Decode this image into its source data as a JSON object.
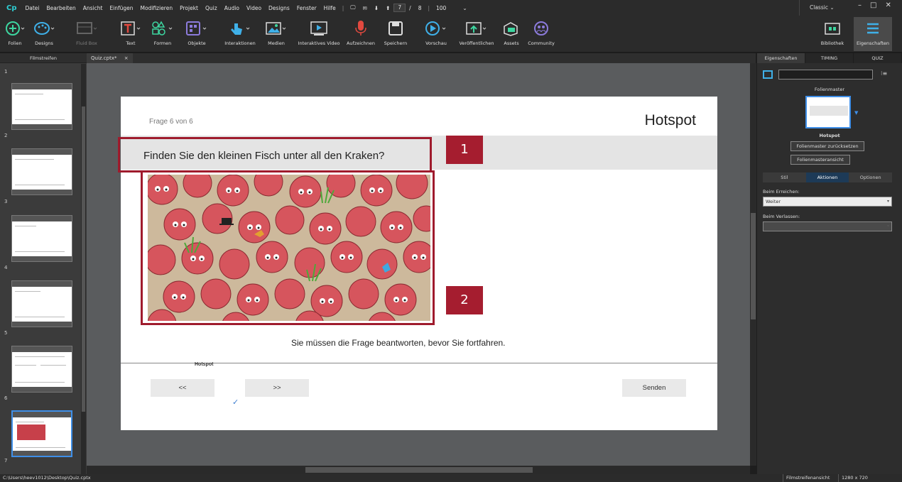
{
  "menubar": {
    "logo": "Cp",
    "items": [
      "Datei",
      "Bearbeiten",
      "Ansicht",
      "Einfügen",
      "Modifizieren",
      "Projekt",
      "Quiz",
      "Audio",
      "Video",
      "Designs",
      "Fenster",
      "Hilfe"
    ],
    "current_slide": "7",
    "slide_sep": "/",
    "total_slides": "8",
    "zoom": "100",
    "workspace": "Classic",
    "window_controls": [
      "–",
      "□",
      "✕"
    ]
  },
  "toolbar": {
    "items": [
      "Folien",
      "Designs",
      "Fluid Box",
      "Text",
      "Formen",
      "Objekte",
      "Interaktionen",
      "Medien",
      "Interaktives Video",
      "Aufzeichnen",
      "Speichern",
      "Vorschau",
      "Veröffentlichen",
      "Assets",
      "Community"
    ],
    "right_items": [
      "Bibliothek",
      "Eigenschaften"
    ]
  },
  "filmstrip": {
    "title": "Filmstreifen",
    "slide_numbers": [
      "1",
      "2",
      "3",
      "4",
      "5",
      "6",
      "7"
    ]
  },
  "document": {
    "tab": "Quiz.cptx*",
    "tab_close": "×"
  },
  "slide": {
    "progress": "Frage 6 von 6",
    "type_title": "Hotspot",
    "question": "Finden Sie den kleinen Fisch unter all den Kraken?",
    "badge1": "1",
    "badge2": "2",
    "warning": "Sie müssen die Frage beantworten, bevor Sie fortfahren.",
    "footer_label": "Hotspot",
    "prev": "<<",
    "next": ">>",
    "submit": "Senden",
    "check": "✓"
  },
  "properties": {
    "tabs": [
      "Eigenschaften",
      "TIMING",
      "QUIZ"
    ],
    "master_title": "Folienmaster",
    "master_name": "Hotspot",
    "reset_btn": "Folienmaster zurücksetzen",
    "view_btn": "Folienmasteransicht",
    "subtabs": [
      "Stil",
      "Aktionen",
      "Optionen"
    ],
    "on_enter_label": "Beim Erreichen:",
    "on_enter_value": "Weiter",
    "on_exit_label": "Beim Verlassen:",
    "on_exit_value": ""
  },
  "status": {
    "path": "C:\\Users\\heev1012\\Desktop\\Quiz.cptx",
    "view": "Filmstreifenansicht",
    "resolution": "1280 x 720"
  },
  "colors": {
    "accent": "#9f1b2d",
    "app_bg": "#2b2b2b",
    "octopus": "#d6555d"
  }
}
